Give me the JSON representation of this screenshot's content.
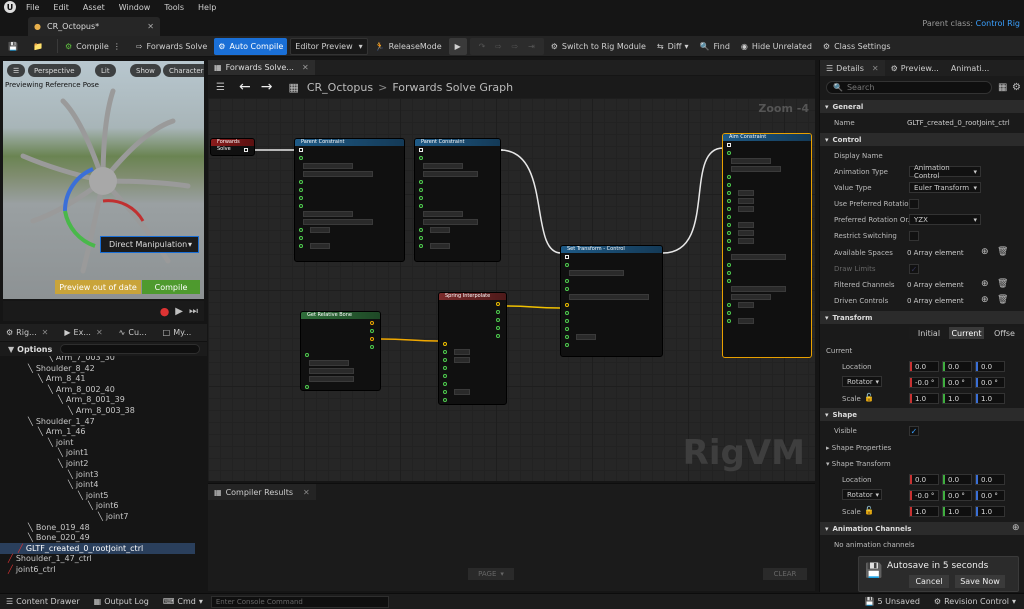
{
  "menu": {
    "items": [
      "File",
      "Edit",
      "Asset",
      "Window",
      "Tools",
      "Help"
    ]
  },
  "document_tab": {
    "title": "CR_Octopus*"
  },
  "parent_class": {
    "label": "Parent class:",
    "value": "Control Rig"
  },
  "toolbar": {
    "compile": "Compile",
    "forwards_solve": "Forwards Solve",
    "auto_compile": "Auto Compile",
    "editor_preview": "Editor Preview",
    "release_mode": "ReleaseMode",
    "switch_rig": "Switch to Rig Module",
    "diff": "Diff",
    "find": "Find",
    "hide_unrelated": "Hide Unrelated",
    "class_settings": "Class Settings"
  },
  "viewport": {
    "buttons": [
      "Perspective",
      "Lit",
      "Show",
      "Character"
    ],
    "preview_label": "Previewing Reference Pose",
    "direct_manipulation": "Direct Manipulation",
    "preview_out_of_date": "Preview out of date",
    "compile": "Compile"
  },
  "left_tabs": [
    "Rig...",
    "Ex...",
    "Cu...",
    "My..."
  ],
  "options_label": "Options",
  "tree": [
    {
      "label": "Arm_7_003_30",
      "d": 4
    },
    {
      "label": "Shoulder_8_42",
      "d": 2
    },
    {
      "label": "Arm_8_41",
      "d": 3
    },
    {
      "label": "Arm_8_002_40",
      "d": 4
    },
    {
      "label": "Arm_8_001_39",
      "d": 5
    },
    {
      "label": "Arm_8_003_38",
      "d": 6
    },
    {
      "label": "Shoulder_1_47",
      "d": 2
    },
    {
      "label": "Arm_1_46",
      "d": 3
    },
    {
      "label": "joint",
      "d": 4
    },
    {
      "label": "joint1",
      "d": 5
    },
    {
      "label": "joint2",
      "d": 5
    },
    {
      "label": "joint3",
      "d": 6
    },
    {
      "label": "joint4",
      "d": 6
    },
    {
      "label": "joint5",
      "d": 7
    },
    {
      "label": "joint6",
      "d": 8
    },
    {
      "label": "joint7",
      "d": 9
    },
    {
      "label": "Bone_019_48",
      "d": 2
    },
    {
      "label": "Bone_020_49",
      "d": 2
    },
    {
      "label": "GLTF_created_0_rootJoint_ctrl",
      "d": 1,
      "sel": true
    },
    {
      "label": "Shoulder_1_47_ctrl",
      "d": 0
    },
    {
      "label": "joint6_ctrl",
      "d": 0
    }
  ],
  "graph": {
    "tab": "Forwards Solve...",
    "breadcrumb_root": "CR_Octopus",
    "breadcrumb_sep": ">",
    "breadcrumb_leaf": "Forwards Solve Graph",
    "zoom": "Zoom -4",
    "watermark": "RigVM",
    "nodes": {
      "forwards": "Forwards Solve",
      "parent1": "Parent Constraint",
      "parent2": "Parent Constraint",
      "settransform": "Set Transform - Control",
      "aim": "Aim Constraint",
      "getrel": "Get Relative Bone",
      "spring": "Spring Interpolate"
    }
  },
  "compiler": {
    "tab": "Compiler Results",
    "page": "PAGE",
    "clear": "CLEAR"
  },
  "details": {
    "tabs": [
      "Details",
      "Preview...",
      "Animati..."
    ],
    "search_placeholder": "Search",
    "general": "General",
    "name_label": "Name",
    "name_value": "GLTF_created_0_rootJoint_ctrl",
    "control": "Control",
    "display_name": "Display Name",
    "animation_type": "Animation Type",
    "animation_type_value": "Animation Control",
    "value_type": "Value Type",
    "value_type_value": "Euler Transform",
    "use_pref_rot": "Use Preferred Rotatio",
    "pref_rot_order": "Preferred Rotation Or...",
    "pref_rot_value": "YZX",
    "restrict_switching": "Restrict Switching",
    "available_spaces": "Available Spaces",
    "array_element": "0 Array element",
    "draw_limits": "Draw Limits",
    "filtered_channels": "Filtered Channels",
    "driven_controls": "Driven Controls",
    "transform": "Transform",
    "seg_initial": "Initial",
    "seg_current": "Current",
    "seg_offset": "Offse",
    "current": "Current",
    "location": "Location",
    "rotator": "Rotator",
    "scale": "Scale",
    "loc_values": [
      "0.0",
      "0.0",
      "0.0"
    ],
    "rot_values": [
      "-0.0 °",
      "0.0 °",
      "0.0 °"
    ],
    "scale_values": [
      "1.0",
      "1.0",
      "1.0"
    ],
    "shape": "Shape",
    "visible": "Visible",
    "shape_properties": "Shape Properties",
    "shape_transform": "Shape Transform",
    "shape_loc_values": [
      "0.0",
      "0.0",
      "0.0"
    ],
    "shape_rot_values": [
      "-0.0 °",
      "0.0 °",
      "0.0 °"
    ],
    "shape_scale_values": [
      "1.0",
      "1.0",
      "1.0"
    ],
    "anim_channels": "Animation Channels",
    "no_anim_channels": "No animation channels"
  },
  "toast": {
    "title": "Autosave in 5 seconds",
    "cancel": "Cancel",
    "save": "Save Now"
  },
  "status": {
    "content_drawer": "Content Drawer",
    "output_log": "Output Log",
    "cmd": "Cmd",
    "console_placeholder": "Enter Console Command",
    "unsaved": "5 Unsaved",
    "revision": "Revision Control"
  }
}
